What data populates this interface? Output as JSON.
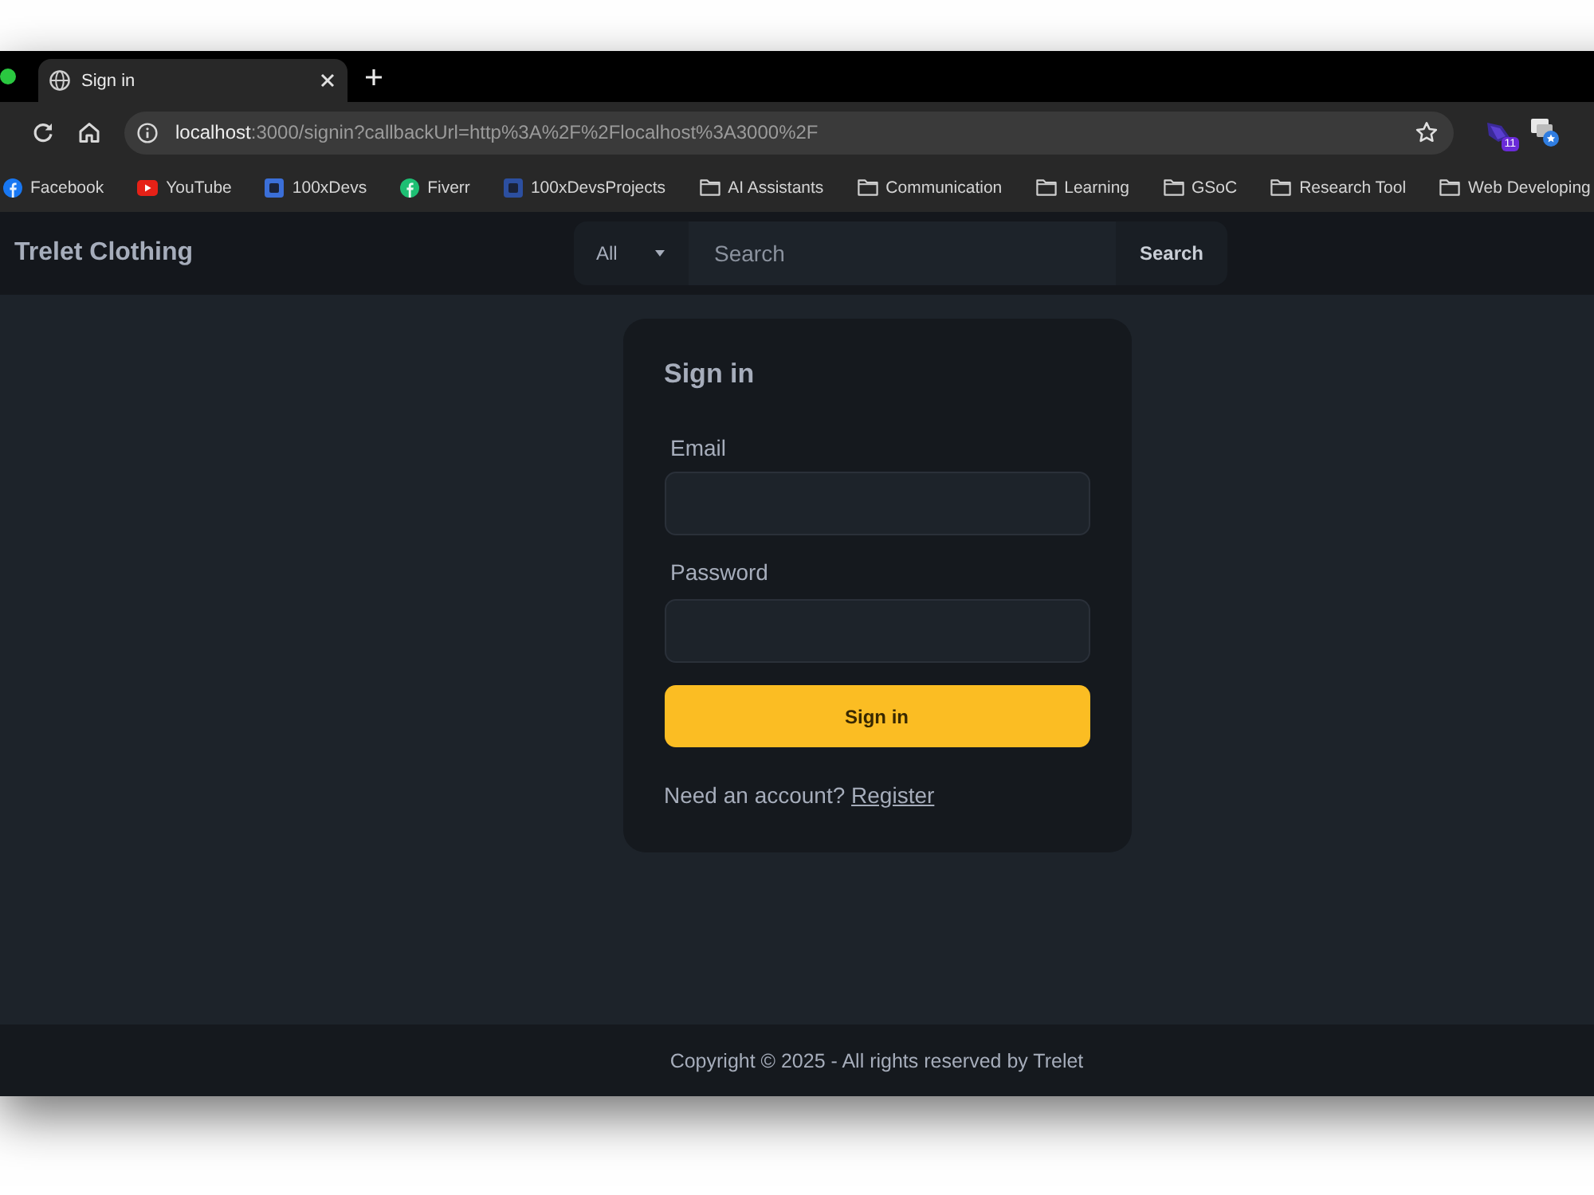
{
  "browser": {
    "tabs": [
      {
        "title": "Sign in",
        "selected": true
      }
    ],
    "address": {
      "host": "localhost",
      "path": ":3000/signin?callbackUrl=http%3A%2F%2Flocalhost%3A3000%2F"
    },
    "extensions": [
      {
        "kind": "badge",
        "badge": "11"
      },
      {
        "kind": "windows"
      }
    ],
    "bookmarks": [
      {
        "label": "Facebook",
        "kind": "disc",
        "color": "#1877f2"
      },
      {
        "label": "YouTube",
        "kind": "play",
        "color": "#e62117"
      },
      {
        "label": "100xDevs",
        "kind": "square",
        "color": "#3b6fd8"
      },
      {
        "label": "Fiverr",
        "kind": "disc",
        "color": "#1dbf73"
      },
      {
        "label": "100xDevsProjects",
        "kind": "square",
        "color": "#2c4fa0"
      },
      {
        "label": "AI Assistants",
        "kind": "folder"
      },
      {
        "label": "Communication",
        "kind": "folder"
      },
      {
        "label": "Learning",
        "kind": "folder"
      },
      {
        "label": "GSoC",
        "kind": "folder"
      },
      {
        "label": "Research Tool",
        "kind": "folder"
      },
      {
        "label": "Web Developing",
        "kind": "folder"
      }
    ]
  },
  "navbar": {
    "brand": "Trelet Clothing",
    "category": "All",
    "search": {
      "placeholder": "Search"
    },
    "search_button": "Search"
  },
  "signin": {
    "title": "Sign in",
    "fields": [
      {
        "label": "Email"
      },
      {
        "label": "Password"
      }
    ],
    "submit": "Sign in",
    "prompt": "Need an account?",
    "link": "Register"
  },
  "footer": {
    "copyright": "Copyright © 2025 - All rights reserved by Trelet"
  }
}
